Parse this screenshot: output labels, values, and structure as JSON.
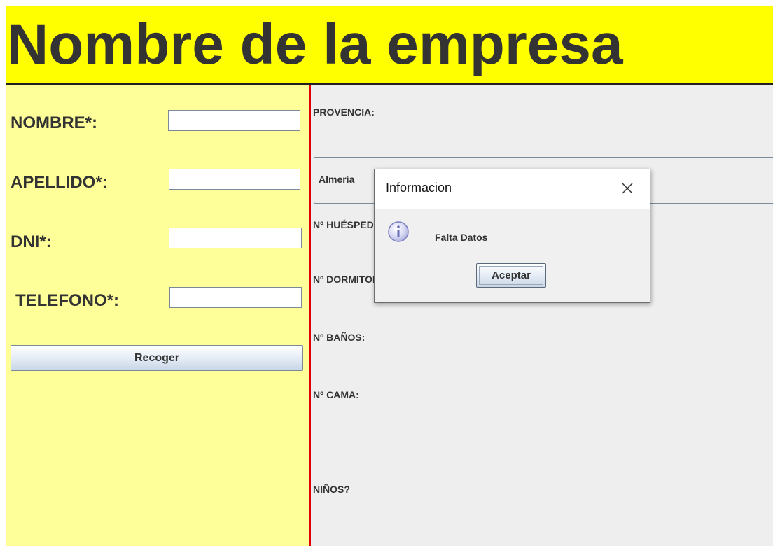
{
  "header": {
    "title": "Nombre de la empresa"
  },
  "form": {
    "fields": [
      {
        "label": "NOMBRE*:",
        "value": ""
      },
      {
        "label": "APELLIDO*:",
        "value": ""
      },
      {
        "label": "DNI*:",
        "value": ""
      },
      {
        "label": "TELEFONO*:",
        "value": ""
      }
    ],
    "submit_label": "Recoger"
  },
  "details": {
    "provincia_label": "PROVENCIA:",
    "provincia_value": "Almería",
    "huespedes_label": "Nº HUÉSPEDES:",
    "dormitorios_label": "Nº DORMITORIOS:",
    "banos_label": "Nº BAÑOS:",
    "cama_label": "Nº CAMA:",
    "ninos_label": "NIÑOS?"
  },
  "dialog": {
    "title": "Informacion",
    "message": "Falta Datos",
    "accept_label": "Aceptar",
    "icon": "info-icon"
  },
  "colors": {
    "header_bg": "#ffff00",
    "left_panel_bg": "#ffff99",
    "divider": "#e00000",
    "right_panel_bg": "#eeeeee"
  }
}
